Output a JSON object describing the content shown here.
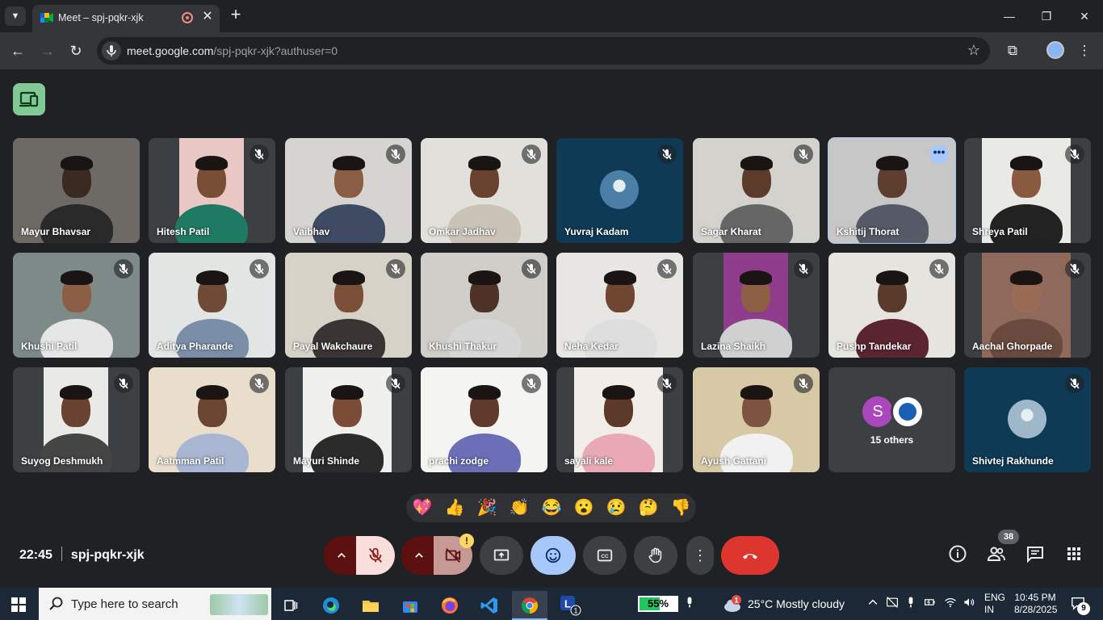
{
  "browser": {
    "tab_title": "Meet – spj-pqkr-xjk",
    "url_host": "meet.google.com",
    "url_path": "/spj-pqkr-xjk?authuser=0"
  },
  "participants": [
    {
      "name": "Mayur Bhavsar",
      "muted": false
    },
    {
      "name": "Hitesh Patil",
      "muted": true
    },
    {
      "name": "Vaibhav",
      "muted": true
    },
    {
      "name": "Omkar Jadhav",
      "muted": true
    },
    {
      "name": "Yuvraj Kadam",
      "muted": true
    },
    {
      "name": "Sagar Kharat",
      "muted": true
    },
    {
      "name": "Kshitij Thorat",
      "muted": false
    },
    {
      "name": "Shreya Patil",
      "muted": true
    },
    {
      "name": "Khushi Patil",
      "muted": true
    },
    {
      "name": "Aditya Pharande",
      "muted": true
    },
    {
      "name": "Payal Wakchaure",
      "muted": true
    },
    {
      "name": "Khushi Thakur",
      "muted": true
    },
    {
      "name": "Neha Kedar",
      "muted": true
    },
    {
      "name": "Lazina Shaikh",
      "muted": true
    },
    {
      "name": "Pushp Tandekar",
      "muted": true
    },
    {
      "name": "Aachal Ghorpade",
      "muted": true
    },
    {
      "name": "Suyog Deshmukh",
      "muted": true
    },
    {
      "name": "Aatmman Patil",
      "muted": true
    },
    {
      "name": "Mayuri Shinde",
      "muted": true
    },
    {
      "name": "prachi zodge",
      "muted": true
    },
    {
      "name": "sayali kale",
      "muted": true
    },
    {
      "name": "Ayush Gattani",
      "muted": true
    },
    {
      "name": "15 others",
      "muted": false
    },
    {
      "name": "Shivtej Rakhunde",
      "muted": true
    }
  ],
  "others_initial": "S",
  "emojis": [
    "💖",
    "👍",
    "🎉",
    "👏",
    "😂",
    "😮",
    "😢",
    "🤔",
    "👎"
  ],
  "meeting": {
    "time": "22:45",
    "code": "spj-pqkr-xjk",
    "people_count": "38"
  },
  "taskbar": {
    "search_placeholder": "Type here to search",
    "battery": "55%",
    "battery_level": 0.55,
    "weather_alert": "1",
    "weather": "25°C  Mostly cloudy",
    "lang1": "ENG",
    "lang2": "IN",
    "time": "10:45 PM",
    "date": "8/28/2025",
    "notifications": "9",
    "app_badge": "1"
  },
  "colors": {
    "background": "#202124",
    "tile": "#3c4043",
    "end_call": "#dc362e",
    "active_tile": "#a8c7fa"
  }
}
